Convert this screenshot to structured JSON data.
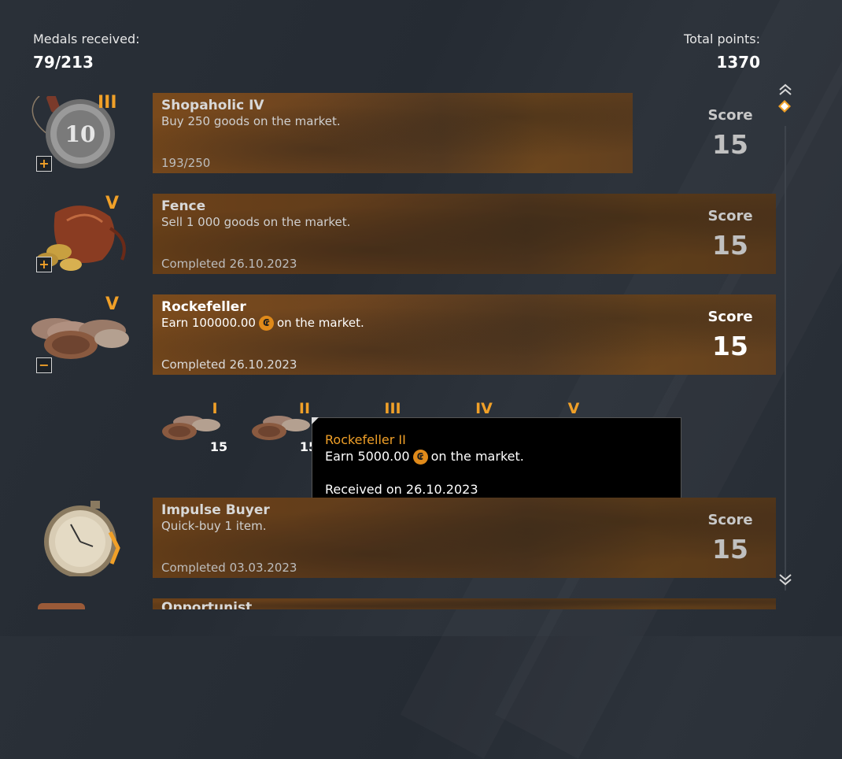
{
  "header": {
    "medals_label": "Medals received:",
    "medals_value": "79/213",
    "points_label": "Total points:",
    "points_value": "1370"
  },
  "achievements": [
    {
      "tier": "III",
      "title": "Shopaholic IV",
      "description": "Buy 250 goods on the market.",
      "status": "193/250",
      "score_label": "Score",
      "score": "15",
      "toggle": "+",
      "medal_icon": "ten-coin-medal-icon"
    },
    {
      "tier": "V",
      "title": "Fence",
      "description": "Sell 1 000 goods on the market.",
      "status": "Completed 26.10.2023",
      "score_label": "Score",
      "score": "15",
      "toggle": "+",
      "medal_icon": "coin-pouch-icon"
    },
    {
      "tier": "V",
      "title": "Rockefeller",
      "description_pre": "Earn 100000.00",
      "description_post": "on the market.",
      "status": "Completed 26.10.2023",
      "score_label": "Score",
      "score": "15",
      "toggle": "−",
      "medal_icon": "coin-stack-icon"
    },
    {
      "title": "Impulse Buyer",
      "description": "Quick-buy 1 item.",
      "status": "Completed 03.03.2023",
      "score_label": "Score",
      "score": "15",
      "medal_icon": "stopwatch-icon"
    },
    {
      "title": "Opportunist",
      "medal_icon": "partial-medal-icon"
    }
  ],
  "subtiers": [
    {
      "roman": "I",
      "score": "15"
    },
    {
      "roman": "II",
      "score": "15"
    },
    {
      "roman": "III"
    },
    {
      "roman": "IV"
    },
    {
      "roman": "V"
    }
  ],
  "tooltip": {
    "title": "Rockefeller II",
    "desc_pre": "Earn 5000.00",
    "desc_post": "on the market.",
    "received": "Received on 26.10.2023"
  },
  "colors": {
    "accent": "#f0a028",
    "panel": "#6e4520",
    "background": "#272d35"
  }
}
